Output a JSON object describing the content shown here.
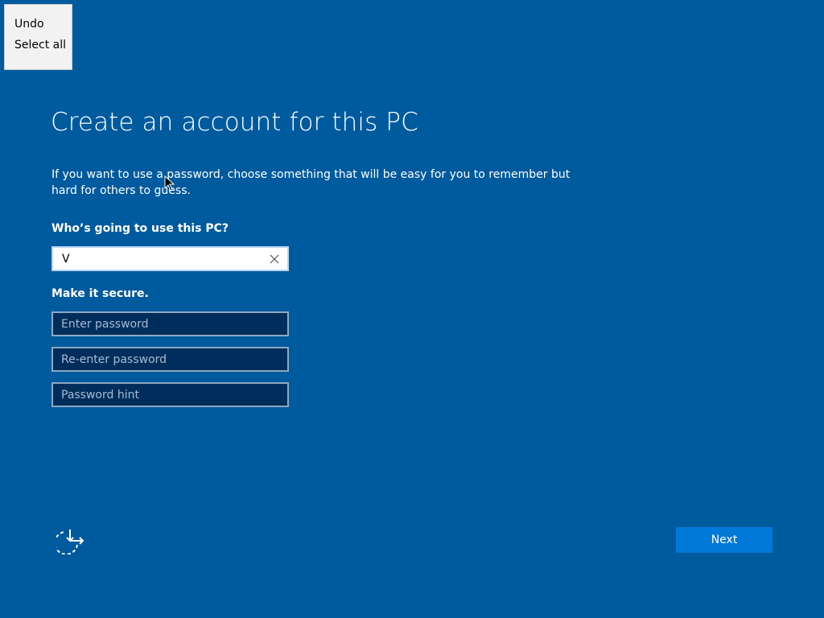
{
  "context_menu": {
    "items": [
      {
        "label": "Undo"
      },
      {
        "label": "Select all"
      }
    ]
  },
  "page": {
    "title": "Create an account for this PC",
    "description": "If you want to use a password, choose something that will be easy for you to remember but hard for others to guess."
  },
  "form": {
    "who_label": "Who’s going to use this PC?",
    "username_value": "V",
    "secure_label": "Make it secure.",
    "password_placeholder": "Enter password",
    "reenter_placeholder": "Re-enter password",
    "hint_placeholder": "Password hint"
  },
  "footer": {
    "next_label": "Next",
    "ease_icon": "ease-of-access-icon"
  },
  "colors": {
    "background": "#005a9e",
    "button": "#0078d7",
    "input_dark": "#002e5c"
  }
}
